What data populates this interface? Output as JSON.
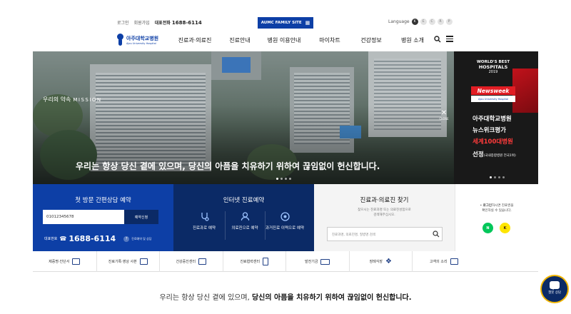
{
  "utility": {
    "login": "로그인",
    "join": "회원가입",
    "call_label": "대표전화",
    "call_number": "1688-6114",
    "family_site": "AUMC FAMILY SITE",
    "language_label": "Language",
    "languages": [
      "K",
      "E",
      "C",
      "R",
      "P"
    ]
  },
  "logo": {
    "ko": "아주대학교병원",
    "en": "Ajou University Hospital"
  },
  "nav": [
    "진료과·의료진",
    "진료안내",
    "병원 이용안내",
    "마이차트",
    "건강정보",
    "병원 소개"
  ],
  "hero": {
    "mission_label": "우리의 약속",
    "mission_en": "MISSION",
    "title": "우리는 항상 당신 곁에 있으며, 당신의 아픔을 치유하기 위하여 끊임없이 헌신합니다."
  },
  "banner": {
    "world_best": "WORLD'S BEST",
    "hospitals": "HOSPITALS",
    "year": "2019",
    "brand": "Newsweek",
    "sub": "Ajou University Hospital",
    "close": "CLOSE",
    "line1": "아주대학교병원",
    "line2": "뉴스위크평가",
    "line3": "세계100대병원",
    "line4": "선정",
    "line4_small": "(국내종합병원 전국1위)"
  },
  "quick": {
    "first_visit": {
      "title": "첫 방문 간편상담 예약",
      "phone_value": "01012345678",
      "apply_button": "예약신청",
      "rep_label": "대표번호",
      "rep_number": "1688-6114",
      "rep_help": "진료예약 및 상담"
    },
    "online": {
      "title": "인터넷 진료예약",
      "items": [
        "진료과로 예약",
        "의료진으로 예약",
        "과거진료 이력으로 예약"
      ]
    },
    "find": {
      "title": "진료과·의료진 찾기",
      "desc1": "찾으시는 진료과명 또는 의료진성함으로",
      "desc2": "검색해주십시오.",
      "placeholder": "진료과명, 의료진명, 질병명 검색"
    },
    "login": {
      "line1_bold": "로그인",
      "line1": "하시면 진료권을",
      "line2": "확인하실 수 있습니다.",
      "naver": "N",
      "kakao": "K"
    }
  },
  "shortcuts": [
    "제증명·진단서",
    "진료기록·영상 사본",
    "건강증진센터",
    "진료협력센터",
    "발전기금",
    "장례식장",
    "고객의 소리"
  ],
  "slogan": {
    "normal": "우리는 항상 당신 곁에 있으며, ",
    "bold": "당신의 아픔을 치유하기 위하여 끊임없이 헌신합니다."
  },
  "chatbot": "챗봇 상담"
}
